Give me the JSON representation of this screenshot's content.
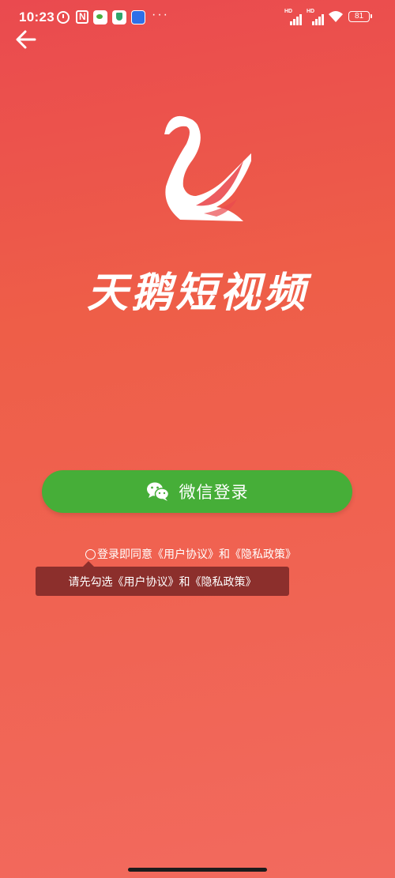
{
  "status_bar": {
    "time": "10:23",
    "battery": "81",
    "signal1_label": "HD",
    "signal2_label": "HD",
    "more": "···",
    "icons": [
      "alarm-icon",
      "nfc-icon",
      "wechat-icon",
      "shield-icon",
      "app-icon",
      "signal-icon",
      "signal-icon",
      "wifi-icon",
      "battery-icon"
    ]
  },
  "header": {
    "back_icon": "back-arrow-icon"
  },
  "brand": {
    "logo_icon": "swan-logo-icon",
    "app_name": "天鹅短视频"
  },
  "login": {
    "wechat_button_label": "微信登录",
    "wechat_icon": "wechat-icon"
  },
  "agreement": {
    "prefix": "登录即同意",
    "user_agreement": "《用户协议》",
    "conjunction": "和",
    "privacy_policy": "《隐私政策》"
  },
  "toast": {
    "message": "请先勾选《用户协议》和《隐私政策》"
  },
  "colors": {
    "background_top": "#ea4a4f",
    "background_bottom": "#f26a5e",
    "wechat_green": "#46ae38",
    "toast_bg": "#8c2f2c"
  }
}
